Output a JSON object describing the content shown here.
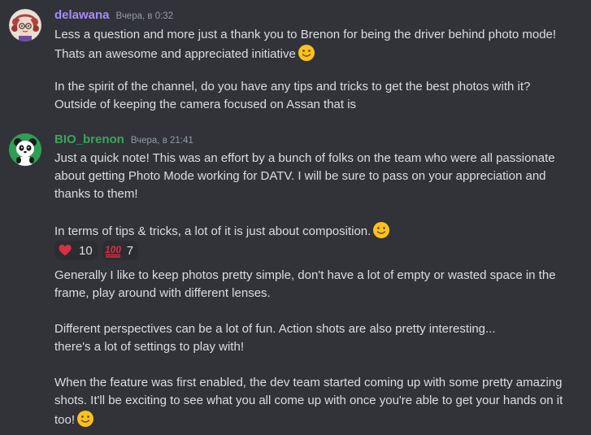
{
  "messages": [
    {
      "username": "delawana",
      "username_color": "#a78bfa",
      "timestamp": "Вчера, в 0:32",
      "avatar_icon": "cartoon-girl-avatar",
      "lines": [
        "Less a question and more just a thank you to Brenon for being the driver behind photo mode!",
        "Thats an awesome and appreciated initiative",
        "In the spirit of the channel, do you have any tips and tricks to get the best photos with it?",
        "Outside of keeping the camera focused on Assan that is"
      ]
    },
    {
      "username": "BIO_brenon",
      "username_color": "#3ba55c",
      "timestamp": "Вчера, в 21:41",
      "avatar_icon": "panda-avatar",
      "lines": [
        "Just a quick note! This was an effort by a bunch of folks on the team who were all passionate",
        "about getting Photo Mode working for DATV. I will be sure to pass on your appreciation and",
        "thanks to them!",
        "In terms of tips & tricks, a lot of it is just about composition.",
        "Generally I like to keep photos pretty simple, don't have a lot of empty or wasted space in the",
        "frame, play around with different lenses.",
        "Different perspectives can be a lot of fun. Action shots are also pretty interesting...",
        "there's a lot of settings to play with!",
        "When the feature was first enabled, the dev team started coming up with some pretty amazing",
        "shots. It'll be exciting to see what you all come up with once you're able to get your hands on it",
        "too!"
      ],
      "reactions": [
        {
          "emoji": "heart-icon",
          "count": "10"
        },
        {
          "emoji": "hundred-points-icon",
          "count": "7"
        }
      ]
    }
  ],
  "colors": {
    "background": "#313338",
    "text": "#dbdee1",
    "timestamp": "#949ba4",
    "reaction_bg": "#2b2d31"
  }
}
